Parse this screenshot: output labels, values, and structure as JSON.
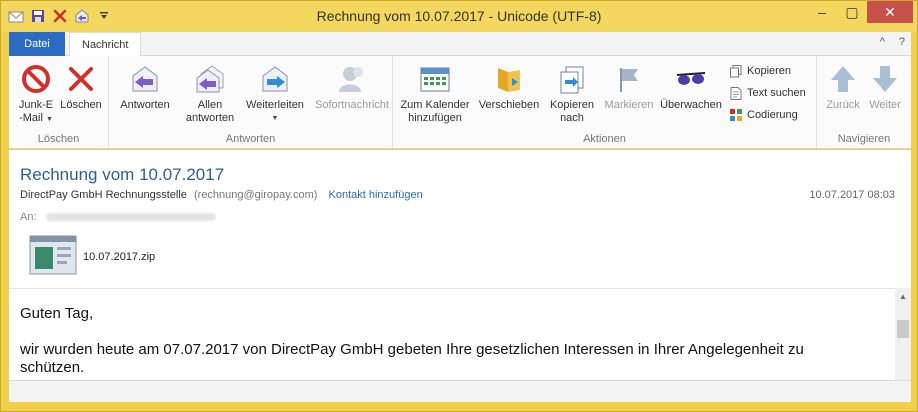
{
  "window": {
    "title": "Rechnung vom 10.07.2017 - Unicode (UTF-8)",
    "accent_color": "#2b6bc4",
    "frame_color": "#f4d75e"
  },
  "titlebar": {
    "minimize": "–",
    "maximize": "▢",
    "close": "✕"
  },
  "tabs": {
    "file": "Datei",
    "message": "Nachricht",
    "help": "?",
    "collapse": "^"
  },
  "ribbon": {
    "loeschen": {
      "label": "Löschen",
      "junk_line1": "Junk-E",
      "junk_line2": "-Mail",
      "delete": "Löschen"
    },
    "antworten": {
      "label": "Antworten",
      "reply": "Antworten",
      "reply_all_line1": "Allen",
      "reply_all_line2": "antworten",
      "forward": "Weiterleiten",
      "instant": "Sofortnachricht"
    },
    "aktionen": {
      "label": "Aktionen",
      "calendar_line1": "Zum Kalender",
      "calendar_line2": "hinzufügen",
      "move": "Verschieben",
      "copy_line1": "Kopieren",
      "copy_line2": "nach",
      "mark": "Markieren",
      "watch": "Überwachen",
      "copy_small": "Kopieren",
      "find_text": "Text suchen",
      "encoding": "Codierung"
    },
    "navigieren": {
      "label": "Navigieren",
      "back": "Zurück",
      "forward": "Weiter"
    }
  },
  "message": {
    "subject": "Rechnung vom 10.07.2017",
    "sender_name": "DirectPay GmbH Rechnungsstelle",
    "sender_email": "(rechnung@giropay.com)",
    "add_contact": "Kontakt hinzufügen",
    "datetime": "10.07.2017 08:03",
    "to_label": "An:",
    "attachment": "10.07.2017.zip",
    "body_greeting": "Guten Tag,",
    "body_line1": "wir wurden heute am 07.07.2017 von DirectPay GmbH gebeten Ihre gesetzlichen Interessen in Ihrer Angelegenheit zu",
    "body_line2": "schützen."
  }
}
